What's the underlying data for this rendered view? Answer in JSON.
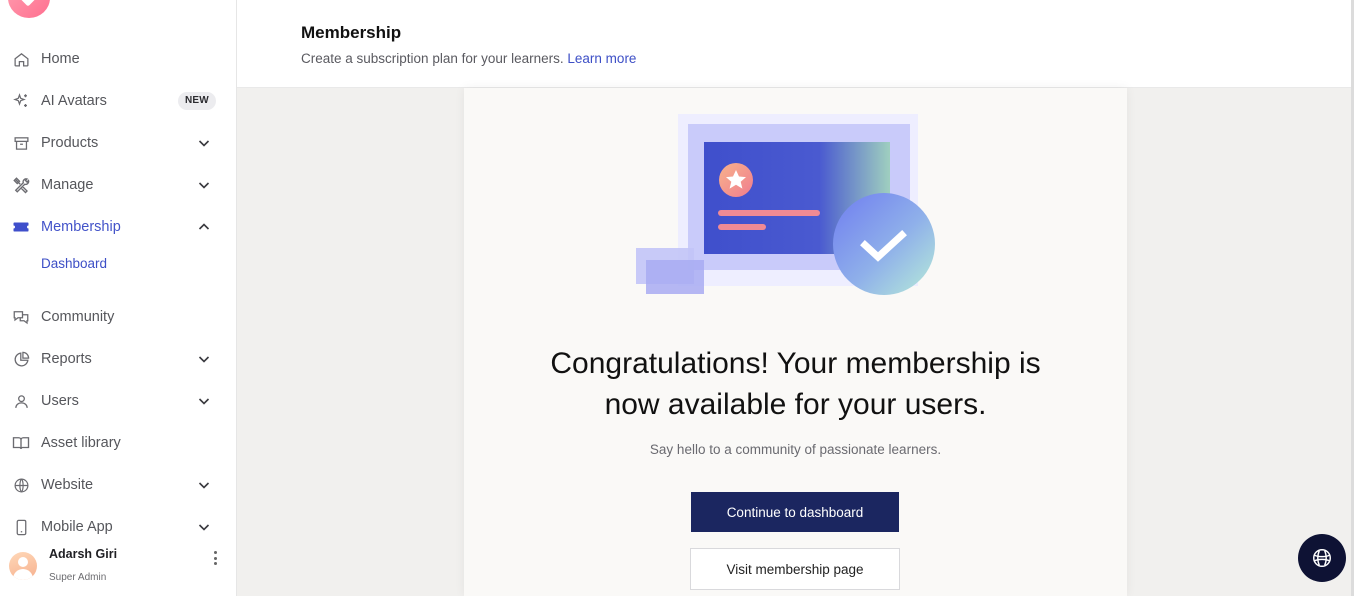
{
  "sidebar": {
    "items": [
      {
        "label": "Home",
        "icon": "home-icon"
      },
      {
        "label": "AI Avatars",
        "icon": "sparkle-icon",
        "badge": "NEW"
      },
      {
        "label": "Products",
        "icon": "archive-icon"
      },
      {
        "label": "Manage",
        "icon": "tools-icon"
      },
      {
        "label": "Membership",
        "icon": "ticket-icon"
      },
      {
        "label": "Community",
        "icon": "chat-bubbles-icon"
      },
      {
        "label": "Reports",
        "icon": "pie-chart-icon"
      },
      {
        "label": "Users",
        "icon": "user-icon"
      },
      {
        "label": "Asset library",
        "icon": "book-icon"
      },
      {
        "label": "Website",
        "icon": "globe-icon"
      },
      {
        "label": "Mobile App",
        "icon": "mobile-icon"
      }
    ],
    "membership_sub": "Dashboard",
    "active_item": "Membership",
    "user": {
      "name": "Adarsh Giri",
      "role": "Super Admin"
    }
  },
  "header": {
    "title": "Membership",
    "subtitle": "Create a subscription plan for your learners.",
    "link": "Learn more"
  },
  "main": {
    "heading_line1": "Congratulations! Your membership is",
    "heading_line2": "now available for your users.",
    "subtext": "Say hello to a community of passionate learners.",
    "primary_button": "Continue to dashboard",
    "secondary_button": "Visit membership page"
  },
  "colors": {
    "accent": "#4353c9",
    "primary_button": "#1b2660",
    "help_button": "#0e1234"
  }
}
